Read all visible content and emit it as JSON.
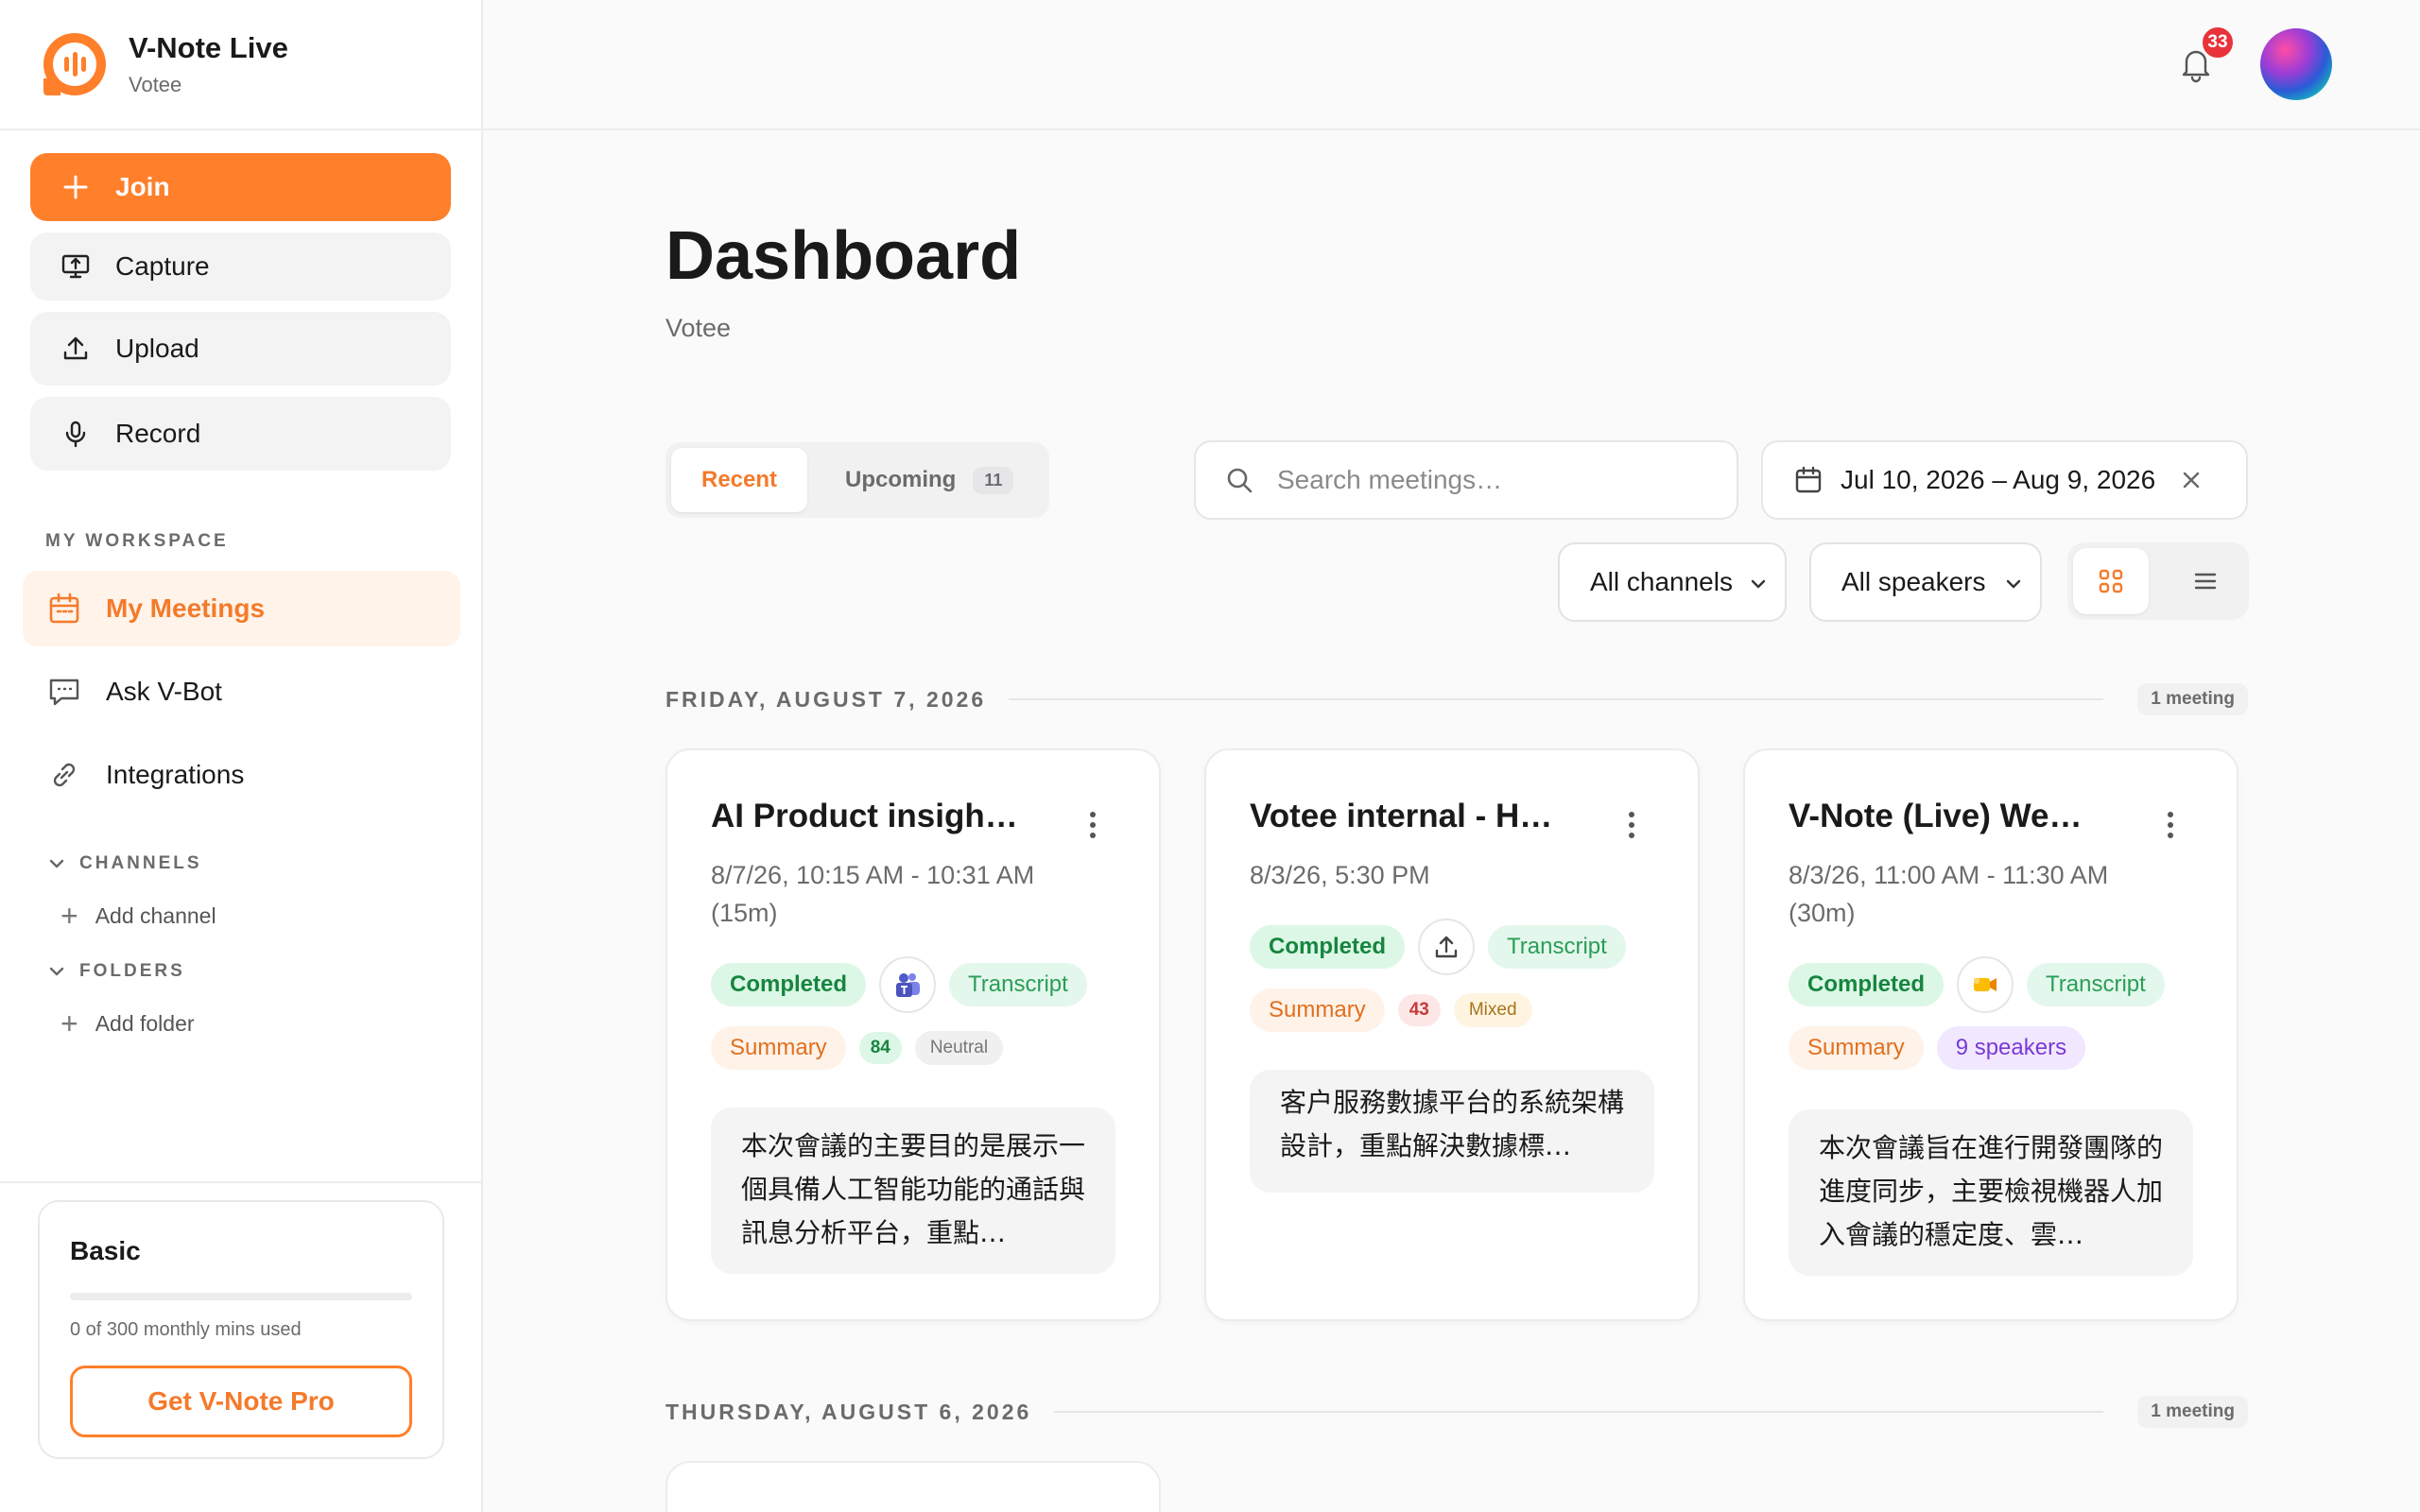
{
  "app": {
    "name": "V-Note Live",
    "workspace": "Votee"
  },
  "sidebar": {
    "actions": [
      {
        "label": "Join",
        "icon": "plus-icon"
      },
      {
        "label": "Capture",
        "icon": "screen-capture-icon"
      },
      {
        "label": "Upload",
        "icon": "upload-icon"
      },
      {
        "label": "Record",
        "icon": "microphone-icon"
      }
    ],
    "section_label": "MY WORKSPACE",
    "nav": [
      {
        "label": "My Meetings",
        "icon": "calendar-icon",
        "active": true
      },
      {
        "label": "Ask V-Bot",
        "icon": "chat-icon",
        "active": false
      },
      {
        "label": "Integrations",
        "icon": "link-icon",
        "active": false
      }
    ],
    "channels": {
      "label": "CHANNELS",
      "add_label": "Add channel"
    },
    "folders": {
      "label": "FOLDERS",
      "add_label": "Add folder"
    },
    "plan": {
      "name": "Basic",
      "usage": "0 of 300 monthly mins used",
      "used_fraction": 0,
      "upgrade_label": "Get V-Note Pro"
    }
  },
  "topbar": {
    "notifications_count": "33"
  },
  "dashboard": {
    "title": "Dashboard",
    "subtitle": "Votee",
    "tabs": [
      {
        "label": "Recent",
        "active": true
      },
      {
        "label": "Upcoming",
        "count": "11",
        "active": false
      }
    ],
    "search": {
      "placeholder": "Search meetings…",
      "value": ""
    },
    "date_range": "Jul 10, 2026 – Aug 9, 2026",
    "filters": {
      "channels": "All channels",
      "speakers": "All speakers"
    },
    "view_mode": "grid"
  },
  "days": [
    {
      "label": "FRIDAY, AUGUST 7, 2026",
      "count": "1 meeting",
      "meetings": [
        {
          "title": "AI Product insigh…",
          "time": "8/7/26, 10:15 AM - 10:31 AM (15m)",
          "status": "Completed",
          "source_icon": "teams-icon",
          "transcript": "Transcript",
          "summary": "Summary",
          "score": "84",
          "sentiment": "Neutral",
          "preview": "本次會議的主要目的是展示一個具備人工智能功能的通話與訊息分析平台，重點…"
        },
        {
          "title": "Votee internal - H…",
          "time": "8/3/26, 5:30 PM",
          "status": "Completed",
          "source_icon": "upload-icon",
          "transcript": "Transcript",
          "summary": "Summary",
          "score": "43",
          "sentiment": "Mixed",
          "preview": "客户服務數據平台的系統架構設計，重點解決數據標…"
        },
        {
          "title": "V-Note (Live) We…",
          "time": "8/3/26, 11:00 AM - 11:30 AM (30m)",
          "status": "Completed",
          "source_icon": "google-meet-icon",
          "transcript": "Transcript",
          "summary": "Summary",
          "speakers": "9 speakers",
          "preview": "本次會議旨在進行開發團隊的進度同步，主要檢視機器人加入會議的穩定度、雲…"
        }
      ]
    },
    {
      "label": "THURSDAY, AUGUST 6, 2026",
      "count": "1 meeting"
    }
  ],
  "colors": {
    "accent": "#ff7f2a",
    "completed": "#17853f",
    "badge": "#e8333a"
  }
}
